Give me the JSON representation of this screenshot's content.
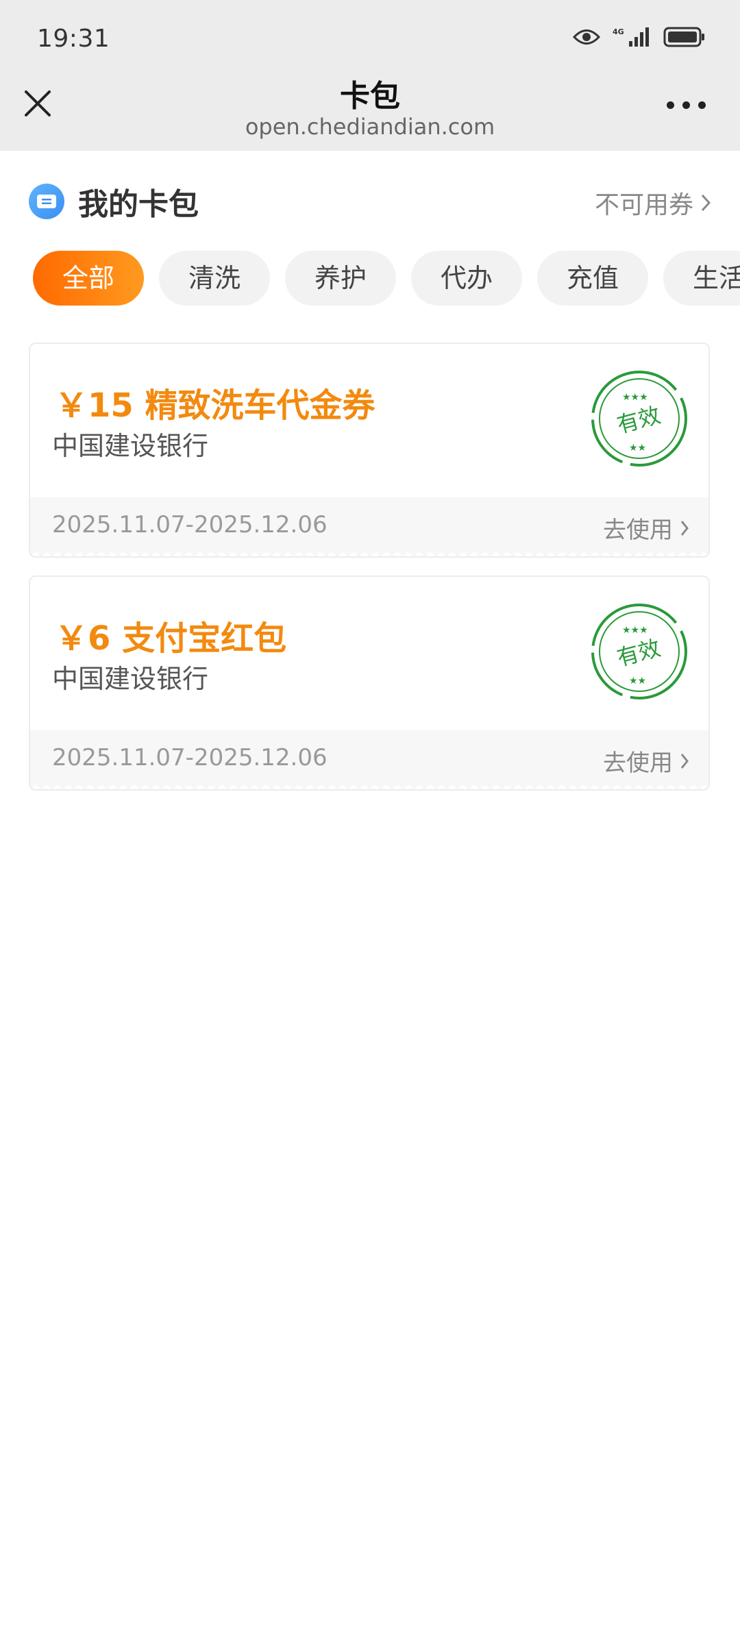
{
  "status_bar": {
    "time": "19:31",
    "network": "4G"
  },
  "nav": {
    "title": "卡包",
    "url": "open.chediandian.com"
  },
  "wallet": {
    "title": "我的卡包",
    "unavailable_link": "不可用券"
  },
  "tabs": [
    {
      "label": "全部",
      "active": true
    },
    {
      "label": "清洗",
      "active": false
    },
    {
      "label": "养护",
      "active": false
    },
    {
      "label": "代办",
      "active": false
    },
    {
      "label": "充值",
      "active": false
    },
    {
      "label": "生活",
      "active": false
    }
  ],
  "coupons": [
    {
      "amount": "￥15 精致洗车代金券",
      "bank": "中国建设银行",
      "date_range": "2025.11.07-2025.12.06",
      "action": "去使用",
      "status_stamp": "有效"
    },
    {
      "amount": "￥6 支付宝红包",
      "bank": "中国建设银行",
      "date_range": "2025.11.07-2025.12.06",
      "action": "去使用",
      "status_stamp": "有效"
    }
  ],
  "colors": {
    "accent": "#f28a0f",
    "stamp_green": "#2a9a3a",
    "header_bg": "#ececec"
  }
}
